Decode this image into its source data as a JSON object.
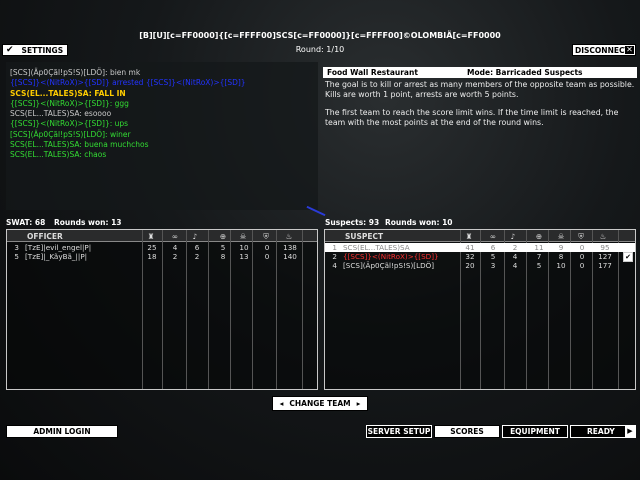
{
  "server_title": "[B][U][c=FF0000]{[c=FFFF00]SCS[c=FF0000]}[c=FFFF00]©OLOMBIÄ[c=FF0000",
  "round": "Round: 1/10",
  "buttons": {
    "settings": "SETTINGS",
    "disconnect": "DISCONNECT",
    "change_team": "CHANGE TEAM",
    "admin_login": "ADMIN LOGIN",
    "server_setup": "SERVER SETUP",
    "scores": "SCORES",
    "equipment": "EQUIPMENT",
    "ready": "READY"
  },
  "chat": [
    {
      "name": "[SCS](Äp0Çãl!pS!S)[LDÖ]:",
      "text": " bien mk",
      "name_color": "#c8c8c8",
      "text_color": "#c8c8c8"
    },
    {
      "name": "{[SCS]}<(NitRoX)>{[SD]}",
      "text": " arrested {[SCS]}<(NitRoX)>{[SD]}",
      "name_color": "#2233ff",
      "text_color": "#2233ff"
    },
    {
      "name": "SCS(EL...TALES)SA:",
      "text": " FALL IN",
      "name_color": "#ffcc00",
      "text_color": "#ffcc00"
    },
    {
      "name": "{[SCS]}<(NitRoX)>{[SD]}:",
      "text": " ggg",
      "name_color": "#33dd33",
      "text_color": "#33dd33"
    },
    {
      "name": "SCS(EL...TALES)SA:",
      "text": " esoooo",
      "name_color": "#c8c8c8",
      "text_color": "#c8c8c8"
    },
    {
      "name": "{[SCS]}<(NitRoX)>{[SD]}:",
      "text": " ups",
      "name_color": "#33dd33",
      "text_color": "#33dd33"
    },
    {
      "name": "[SCS](Äp0Çãl!pS!S)[LDÖ]:",
      "text": " winer",
      "name_color": "#33dd33",
      "text_color": "#33dd33"
    },
    {
      "name": "SCS(EL...TALES)SA:",
      "text": " buena muchchos",
      "name_color": "#33dd33",
      "text_color": "#33dd33"
    },
    {
      "name": "SCS(EL...TALES)SA:",
      "text": " chaos",
      "name_color": "#33dd33",
      "text_color": "#33dd33"
    }
  ],
  "map_info": {
    "map_name": "Food Wall Restaurant",
    "mode": "Mode: Barricaded Suspects",
    "paragraph1": "The goal is to kill or arrest as many members of the opposite team as possible.  Kills are worth 1 point, arrests are worth 5 points.",
    "paragraph2": "The first team to reach the score limit wins.  If the time limit is reached, the team with the most points at the end of the round wins."
  },
  "swat": {
    "header": "SWAT: 68",
    "rounds": "Rounds won: 13",
    "column_name": "OFFICER",
    "rows": [
      {
        "num": "3",
        "name": "[TzE]|evil_engel|P|",
        "c1": "25",
        "c2": "4",
        "c3": "6",
        "c4": "5",
        "c5": "10",
        "c6": "0",
        "c7": "138"
      },
      {
        "num": "5",
        "name": "[TzE]|_KãyBã_||P|",
        "c1": "18",
        "c2": "2",
        "c3": "2",
        "c4": "8",
        "c5": "13",
        "c6": "0",
        "c7": "140"
      }
    ]
  },
  "suspects": {
    "header": "Suspects: 93",
    "rounds": "Rounds won: 10",
    "column_name": "SUSPECT",
    "rows": [
      {
        "num": "1",
        "name": "SCS(EL...TALES)SA",
        "c1": "41",
        "c2": "6",
        "c3": "2",
        "c4": "11",
        "c5": "9",
        "c6": "0",
        "c7": "95"
      },
      {
        "num": "2",
        "name": "{[SCS]}<(NitRoX)>{[SD]}",
        "c1": "32",
        "c2": "5",
        "c3": "4",
        "c4": "7",
        "c5": "8",
        "c6": "0",
        "c7": "127"
      },
      {
        "num": "4",
        "name": "[SCS](Äp0Çãl!pS!S)[LDÖ]",
        "c1": "20",
        "c2": "3",
        "c3": "4",
        "c4": "5",
        "c5": "10",
        "c6": "0",
        "c7": "177"
      }
    ]
  }
}
